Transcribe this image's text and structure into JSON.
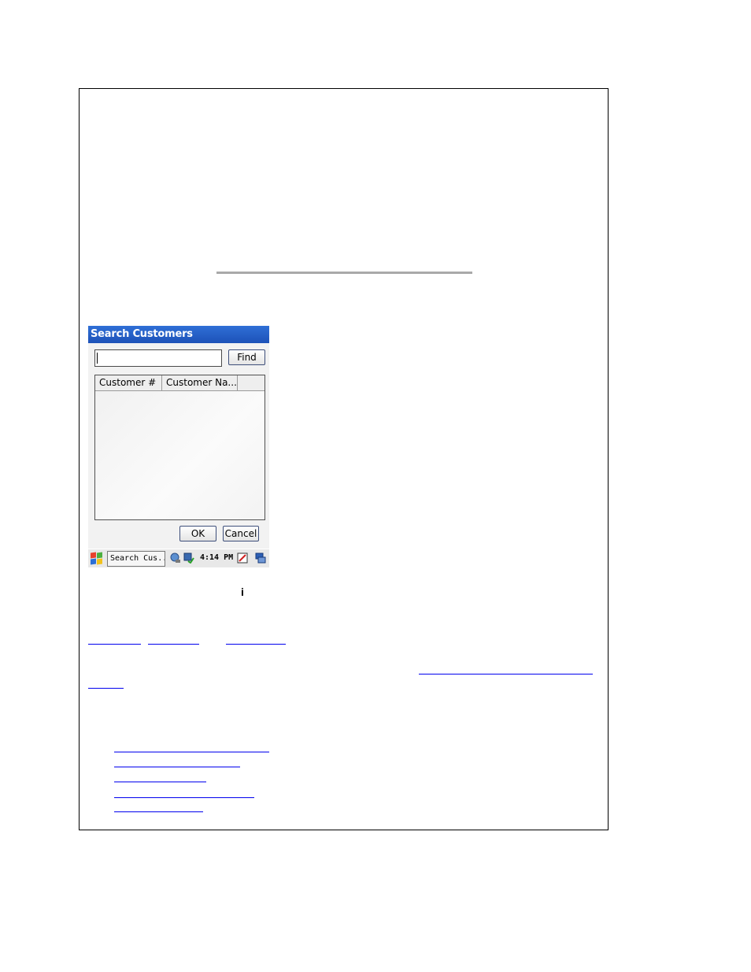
{
  "dialog": {
    "title": "Search Customers",
    "search_value": "",
    "find_label": "Find",
    "columns": [
      "Customer #",
      "Customer Na...",
      ""
    ],
    "rows": [],
    "ok_label": "OK",
    "cancel_label": "Cancel"
  },
  "taskbar": {
    "active_task": "Search Cus...",
    "time": "4:14 PM"
  },
  "info_glyph": "i",
  "colors": {
    "title_bar": "#1d52b8",
    "link": "#0000ee",
    "frame": "#000000"
  }
}
